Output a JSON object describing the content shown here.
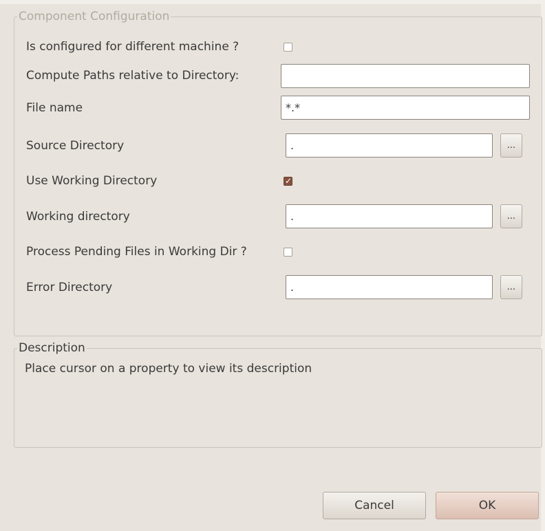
{
  "config_group": {
    "title": "Component Configuration",
    "fields": {
      "different_machine": {
        "label": "Is configured for different machine ?",
        "checked": false
      },
      "compute_paths": {
        "label": "Compute Paths relative to Directory:",
        "value": ""
      },
      "file_name": {
        "label": "File name",
        "value": "*.*"
      },
      "source_directory": {
        "label": "Source Directory",
        "value": ".",
        "browse_label": "..."
      },
      "use_working_directory": {
        "label": "Use Working Directory",
        "checked": true
      },
      "working_directory": {
        "label": "Working directory",
        "value": ".",
        "browse_label": "..."
      },
      "process_pending": {
        "label": "Process Pending Files in Working Dir ?",
        "checked": false
      },
      "error_directory": {
        "label": "Error Directory",
        "value": ".",
        "browse_label": "..."
      }
    }
  },
  "description_group": {
    "title": "Description",
    "text": "Place cursor on a property to view its description"
  },
  "buttons": {
    "cancel": "Cancel",
    "ok": "OK"
  },
  "colors": {
    "background": "#e8e3dc",
    "checkbox_checked": "#86523f",
    "ok_button": "#dcbfb2"
  }
}
